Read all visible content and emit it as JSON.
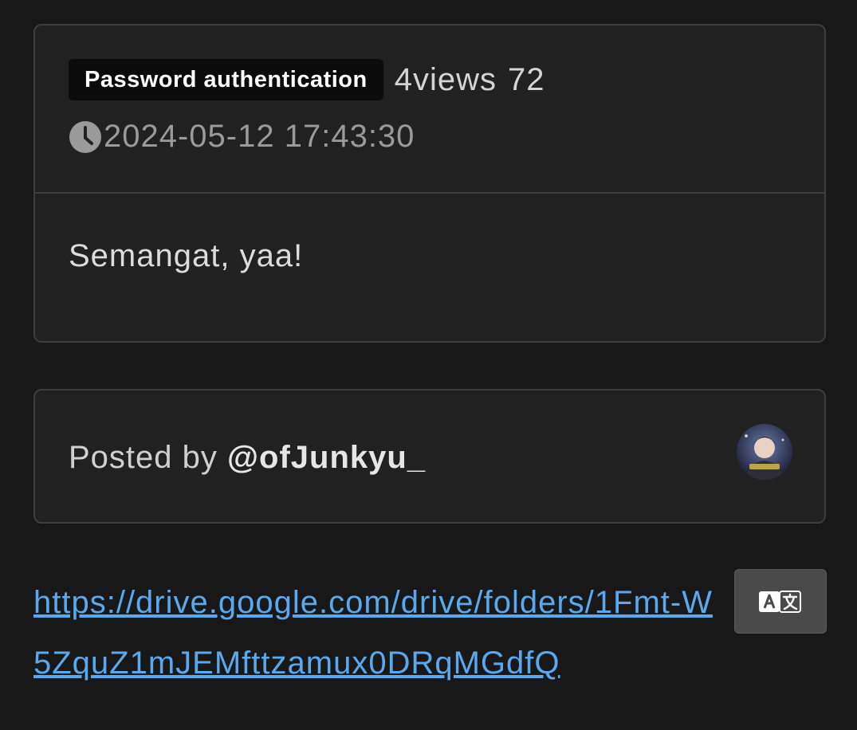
{
  "post": {
    "badge": "Password authentication",
    "views_label": "4views",
    "views_count": "72",
    "timestamp": "2024-05-12 17:43:30",
    "message": "Semangat, yaa!"
  },
  "author": {
    "posted_by_label": "Posted by",
    "handle": "@ofJunkyu_"
  },
  "link": {
    "url": "https://drive.google.com/drive/folders/1Fmt-W5ZquZ1mJEMfttzamux0DRqMGdfQ"
  },
  "colors": {
    "background": "#181818",
    "card": "#212121",
    "border": "#3d3d3d",
    "link": "#5aa9ee",
    "badge_bg": "#0b0b0b"
  },
  "icons": {
    "clock": "clock-icon",
    "translate": "translate-icon"
  }
}
